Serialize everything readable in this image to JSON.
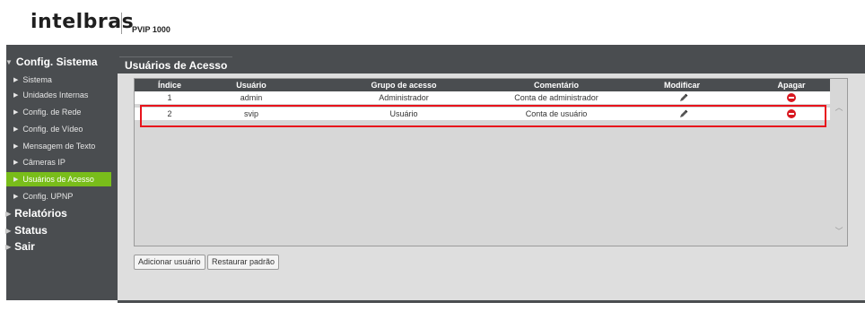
{
  "header": {
    "logo": "intelbras",
    "model": "PVIP 1000"
  },
  "sidebar": {
    "config_title": "Config. Sistema",
    "items": [
      {
        "label": "Sistema"
      },
      {
        "label": "Unidades Internas"
      },
      {
        "label": "Config. de Rede"
      },
      {
        "label": "Config. de Vídeo"
      },
      {
        "label": "Mensagem de Texto"
      },
      {
        "label": "Câmeras IP"
      },
      {
        "label": "Usuários de Acesso",
        "active": true
      },
      {
        "label": "Config. UPNP"
      }
    ],
    "sections": [
      {
        "label": "Relatórios"
      },
      {
        "label": "Status"
      },
      {
        "label": "Sair"
      }
    ]
  },
  "tab": {
    "label": "Usuários de Acesso"
  },
  "table": {
    "headers": [
      "Índice",
      "Usuário",
      "Grupo de acesso",
      "Comentário",
      "Modificar",
      "Apagar"
    ],
    "rows": [
      {
        "index": "1",
        "user": "admin",
        "group": "Administrador",
        "comment": "Conta de administrador"
      },
      {
        "index": "2",
        "user": "svip",
        "group": "Usuário",
        "comment": "Conta de usuário"
      }
    ]
  },
  "buttons": {
    "add": "Adicionar usuário",
    "restore": "Restaurar padrão"
  },
  "colors": {
    "sidebar_bg": "#4a4d50",
    "active_green": "#79bd1a",
    "highlight_red": "#e8141c",
    "delete_red": "#d8171f"
  }
}
